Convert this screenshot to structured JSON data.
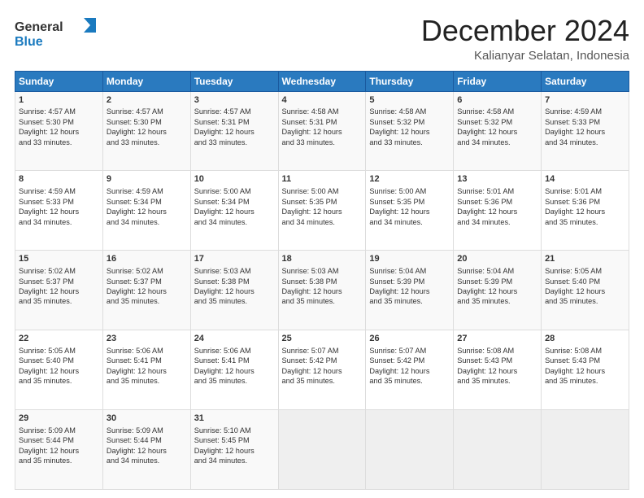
{
  "header": {
    "logo_general": "General",
    "logo_blue": "Blue",
    "month_title": "December 2024",
    "location": "Kalianyar Selatan, Indonesia"
  },
  "days_of_week": [
    "Sunday",
    "Monday",
    "Tuesday",
    "Wednesday",
    "Thursday",
    "Friday",
    "Saturday"
  ],
  "weeks": [
    [
      {
        "day": "1",
        "sunrise": "4:57 AM",
        "sunset": "5:30 PM",
        "daylight": "12 hours and 33 minutes."
      },
      {
        "day": "2",
        "sunrise": "4:57 AM",
        "sunset": "5:30 PM",
        "daylight": "12 hours and 33 minutes."
      },
      {
        "day": "3",
        "sunrise": "4:57 AM",
        "sunset": "5:31 PM",
        "daylight": "12 hours and 33 minutes."
      },
      {
        "day": "4",
        "sunrise": "4:58 AM",
        "sunset": "5:31 PM",
        "daylight": "12 hours and 33 minutes."
      },
      {
        "day": "5",
        "sunrise": "4:58 AM",
        "sunset": "5:32 PM",
        "daylight": "12 hours and 33 minutes."
      },
      {
        "day": "6",
        "sunrise": "4:58 AM",
        "sunset": "5:32 PM",
        "daylight": "12 hours and 34 minutes."
      },
      {
        "day": "7",
        "sunrise": "4:59 AM",
        "sunset": "5:33 PM",
        "daylight": "12 hours and 34 minutes."
      }
    ],
    [
      {
        "day": "8",
        "sunrise": "4:59 AM",
        "sunset": "5:33 PM",
        "daylight": "12 hours and 34 minutes."
      },
      {
        "day": "9",
        "sunrise": "4:59 AM",
        "sunset": "5:34 PM",
        "daylight": "12 hours and 34 minutes."
      },
      {
        "day": "10",
        "sunrise": "5:00 AM",
        "sunset": "5:34 PM",
        "daylight": "12 hours and 34 minutes."
      },
      {
        "day": "11",
        "sunrise": "5:00 AM",
        "sunset": "5:35 PM",
        "daylight": "12 hours and 34 minutes."
      },
      {
        "day": "12",
        "sunrise": "5:00 AM",
        "sunset": "5:35 PM",
        "daylight": "12 hours and 34 minutes."
      },
      {
        "day": "13",
        "sunrise": "5:01 AM",
        "sunset": "5:36 PM",
        "daylight": "12 hours and 34 minutes."
      },
      {
        "day": "14",
        "sunrise": "5:01 AM",
        "sunset": "5:36 PM",
        "daylight": "12 hours and 35 minutes."
      }
    ],
    [
      {
        "day": "15",
        "sunrise": "5:02 AM",
        "sunset": "5:37 PM",
        "daylight": "12 hours and 35 minutes."
      },
      {
        "day": "16",
        "sunrise": "5:02 AM",
        "sunset": "5:37 PM",
        "daylight": "12 hours and 35 minutes."
      },
      {
        "day": "17",
        "sunrise": "5:03 AM",
        "sunset": "5:38 PM",
        "daylight": "12 hours and 35 minutes."
      },
      {
        "day": "18",
        "sunrise": "5:03 AM",
        "sunset": "5:38 PM",
        "daylight": "12 hours and 35 minutes."
      },
      {
        "day": "19",
        "sunrise": "5:04 AM",
        "sunset": "5:39 PM",
        "daylight": "12 hours and 35 minutes."
      },
      {
        "day": "20",
        "sunrise": "5:04 AM",
        "sunset": "5:39 PM",
        "daylight": "12 hours and 35 minutes."
      },
      {
        "day": "21",
        "sunrise": "5:05 AM",
        "sunset": "5:40 PM",
        "daylight": "12 hours and 35 minutes."
      }
    ],
    [
      {
        "day": "22",
        "sunrise": "5:05 AM",
        "sunset": "5:40 PM",
        "daylight": "12 hours and 35 minutes."
      },
      {
        "day": "23",
        "sunrise": "5:06 AM",
        "sunset": "5:41 PM",
        "daylight": "12 hours and 35 minutes."
      },
      {
        "day": "24",
        "sunrise": "5:06 AM",
        "sunset": "5:41 PM",
        "daylight": "12 hours and 35 minutes."
      },
      {
        "day": "25",
        "sunrise": "5:07 AM",
        "sunset": "5:42 PM",
        "daylight": "12 hours and 35 minutes."
      },
      {
        "day": "26",
        "sunrise": "5:07 AM",
        "sunset": "5:42 PM",
        "daylight": "12 hours and 35 minutes."
      },
      {
        "day": "27",
        "sunrise": "5:08 AM",
        "sunset": "5:43 PM",
        "daylight": "12 hours and 35 minutes."
      },
      {
        "day": "28",
        "sunrise": "5:08 AM",
        "sunset": "5:43 PM",
        "daylight": "12 hours and 35 minutes."
      }
    ],
    [
      {
        "day": "29",
        "sunrise": "5:09 AM",
        "sunset": "5:44 PM",
        "daylight": "12 hours and 35 minutes."
      },
      {
        "day": "30",
        "sunrise": "5:09 AM",
        "sunset": "5:44 PM",
        "daylight": "12 hours and 34 minutes."
      },
      {
        "day": "31",
        "sunrise": "5:10 AM",
        "sunset": "5:45 PM",
        "daylight": "12 hours and 34 minutes."
      },
      null,
      null,
      null,
      null
    ]
  ],
  "labels": {
    "sunrise": "Sunrise: ",
    "sunset": "Sunset: ",
    "daylight": "Daylight: "
  }
}
